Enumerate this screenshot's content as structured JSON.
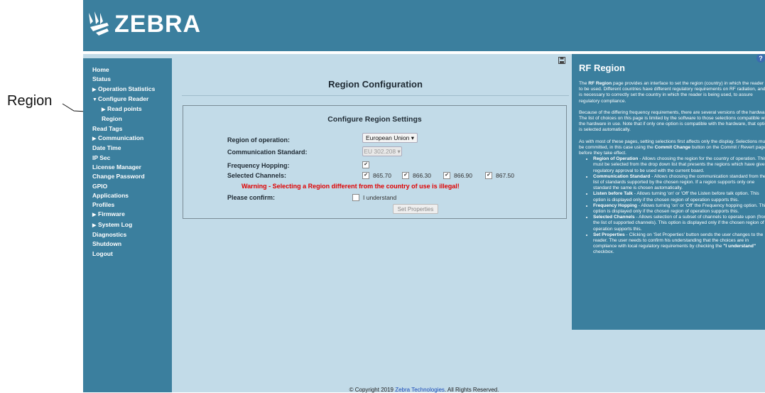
{
  "callout": {
    "label": "Region"
  },
  "header": {
    "logo_text": "ZEBRA"
  },
  "sidebar": {
    "items": [
      {
        "label": "Home",
        "level": 1,
        "arrow": ""
      },
      {
        "label": "Status",
        "level": 1,
        "arrow": ""
      },
      {
        "label": "Operation Statistics",
        "level": 1,
        "arrow": "▶"
      },
      {
        "label": "Configure Reader",
        "level": 1,
        "arrow": "▼"
      },
      {
        "label": "Read points",
        "level": 2,
        "arrow": "▶"
      },
      {
        "label": "Region",
        "level": 2,
        "arrow": ""
      },
      {
        "label": "Read Tags",
        "level": 1,
        "arrow": ""
      },
      {
        "label": "Communication",
        "level": 1,
        "arrow": "▶"
      },
      {
        "label": "Date Time",
        "level": 1,
        "arrow": ""
      },
      {
        "label": "IP Sec",
        "level": 1,
        "arrow": ""
      },
      {
        "label": "License Manager",
        "level": 1,
        "arrow": ""
      },
      {
        "label": "Change Password",
        "level": 1,
        "arrow": ""
      },
      {
        "label": "GPIO",
        "level": 1,
        "arrow": ""
      },
      {
        "label": "Applications",
        "level": 1,
        "arrow": ""
      },
      {
        "label": "Profiles",
        "level": 1,
        "arrow": ""
      },
      {
        "label": "Firmware",
        "level": 1,
        "arrow": "▶"
      },
      {
        "label": "System Log",
        "level": 1,
        "arrow": "▶"
      },
      {
        "label": "Diagnostics",
        "level": 1,
        "arrow": ""
      },
      {
        "label": "Shutdown",
        "level": 1,
        "arrow": ""
      },
      {
        "label": "Logout",
        "level": 1,
        "arrow": ""
      }
    ]
  },
  "main": {
    "page_title": "Region Configuration",
    "box_title": "Configure Region Settings",
    "labels": {
      "region": "Region of operation:",
      "standard": "Communication Standard:",
      "hopping": "Frequency Hopping:",
      "channels": "Selected Channels:",
      "confirm": "Please confirm:"
    },
    "region_value": "European Union ▾",
    "standard_value": "EU 302.208 ▾",
    "frequency_hopping_checked": true,
    "channels": [
      {
        "label": "865.70",
        "checked": true
      },
      {
        "label": "866.30",
        "checked": true
      },
      {
        "label": "866.90",
        "checked": true
      },
      {
        "label": "867.50",
        "checked": true
      }
    ],
    "warning": "Warning - Selecting a Region different from the country of use is illegal!",
    "understand_label": "I understand",
    "set_button": "Set Properties"
  },
  "help": {
    "title": "RF Region",
    "q_icon": "?",
    "p1_a": "The ",
    "p1_b": "RF Region",
    "p1_c": " page provides an interface to set the region (country) in which the reader is to be used. Different countries have different regulatory requirements on RF radiation, and it is necessary to correctly set the country in which the reader is being used, to assure regulatory compliance.",
    "p2": "Because of the differing frequency requirements, there are several versions of the hardware. The list of choices on this page is limited by the software to those selections compatible with the hardware in use. Note that if only one option is compatible with the hardware, that option is selected automatically.",
    "p3_a": "As with most of these pages, setting selections first affects only the display. Selections must be committed, in this case using the ",
    "p3_b": "Commit Change",
    "p3_c": " button on the Commit / Revert page, before they take effect.",
    "bullets": [
      {
        "head": "Region of Operation",
        "text": " - Allows choosing the region for the country of operation. This must be selected from the drop down list that presents the regions which have given regulatory approval to be used with the current board."
      },
      {
        "head": "Communication Standard",
        "text": " - Allows choosing the communication standard from the list of standards supported by the chosen region. If a region supports only one standard the same is chosen automatically."
      },
      {
        "head": "Listen before Talk",
        "text": " - Allows turning 'on' or 'Off' the Listen before talk option. This option is displayed only if the chosen region of operation supports this."
      },
      {
        "head": "Frequency Hopping",
        "text": " - Allows turning 'on' or 'Off' the Frequency hopping option. This option is displayed only if the chosen region of operation supports this."
      },
      {
        "head": "Selected Channels",
        "text": " - Allows selection of a subset of channels to operate upon (from the list of supported channels). This option is displayed only if the chosen region of operation supports this."
      },
      {
        "head": "Set Properties",
        "text": " - Clicking on 'Set Properties' button sends the user changes to the reader. The user needs to confirm his understanding that the choices are in compliance with local regulatory requirements by checking the "
      },
      {
        "head": "",
        "text": ""
      }
    ],
    "last_bold": "\"I understand\"",
    "last_tail": " checkbox."
  },
  "footer": {
    "prefix": "© Copyright 2019 ",
    "link": "Zebra Technologies",
    "suffix": ". All Rights Reserved."
  }
}
